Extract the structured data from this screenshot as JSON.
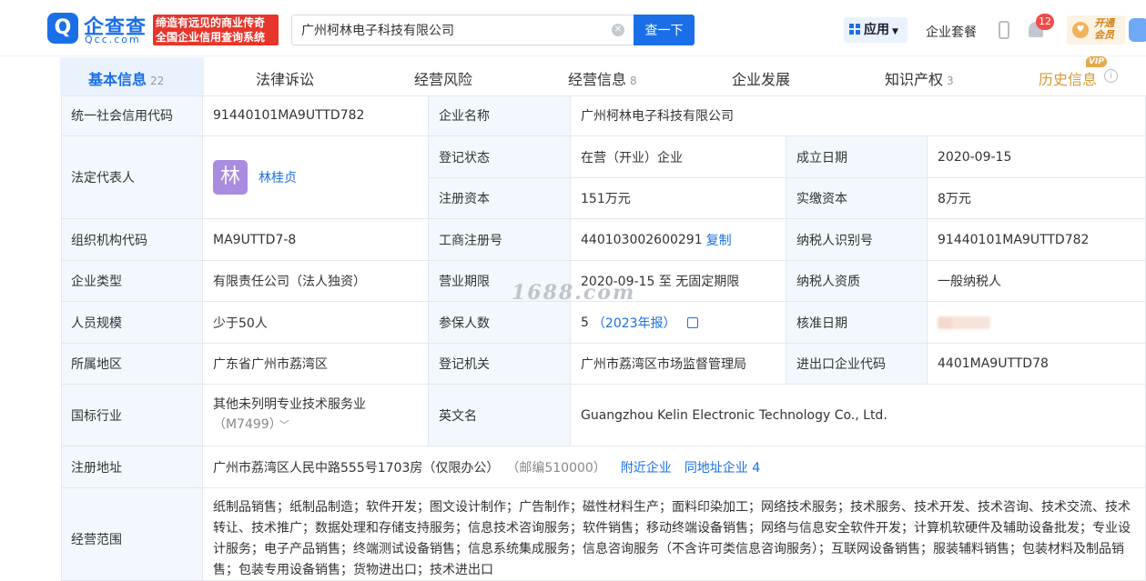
{
  "header": {
    "logo_mark": "Q",
    "logo_cn": "企查查",
    "logo_en": "Qcc.com",
    "slogan_line1": "缔造有远见的商业传奇",
    "slogan_line2": "全国企业信用查询系统",
    "search_value": "广州柯林电子科技有限公司",
    "search_button": "查一下",
    "app_label": "应用",
    "package_label": "企业套餐",
    "notification_count": "12",
    "vip_label": "开通\n会员"
  },
  "tabs": [
    {
      "label": "基本信息",
      "count": "22"
    },
    {
      "label": "法律诉讼",
      "count": ""
    },
    {
      "label": "经营风险",
      "count": ""
    },
    {
      "label": "经营信息",
      "count": "8"
    },
    {
      "label": "企业发展",
      "count": ""
    },
    {
      "label": "知识产权",
      "count": "3"
    },
    {
      "label": "历史信息",
      "count": "",
      "tag": "VIP"
    }
  ],
  "info": {
    "credit_code_label": "统一社会信用代码",
    "credit_code": "91440101MA9UTTD782",
    "company_name_label": "企业名称",
    "company_name": "广州柯林电子科技有限公司",
    "legal_rep_label": "法定代表人",
    "legal_rep_avatar": "林",
    "legal_rep": "林桂贞",
    "reg_status_label": "登记状态",
    "reg_status": "在营（开业）企业",
    "found_date_label": "成立日期",
    "found_date": "2020-09-15",
    "reg_capital_label": "注册资本",
    "reg_capital": "151万元",
    "paid_capital_label": "实缴资本",
    "paid_capital": "8万元",
    "org_code_label": "组织机构代码",
    "org_code": "MA9UTTD7-8",
    "biz_reg_no_label": "工商注册号",
    "biz_reg_no": "440103002600291",
    "copy_label": "复制",
    "taxpayer_id_label": "纳税人识别号",
    "taxpayer_id": "91440101MA9UTTD782",
    "company_type_label": "企业类型",
    "company_type": "有限责任公司（法人独资）",
    "biz_term_label": "营业期限",
    "biz_term": "2020-09-15 至 无固定期限",
    "taxpayer_qual_label": "纳税人资质",
    "taxpayer_qual": "一般纳税人",
    "staff_size_label": "人员规模",
    "staff_size": "少于50人",
    "insured_label": "参保人数",
    "insured_count": "5",
    "insured_report": "（2023年报）",
    "approve_date_label": "核准日期",
    "region_label": "所属地区",
    "region": "广东省广州市荔湾区",
    "reg_authority_label": "登记机关",
    "reg_authority": "广州市荔湾区市场监督管理局",
    "ie_code_label": "进出口企业代码",
    "ie_code": "4401MA9UTTD78",
    "industry_label": "国标行业",
    "industry": "其他未列明专业技术服务业",
    "industry_code": "（M7499）",
    "english_name_label": "英文名",
    "english_name": "Guangzhou Kelin Electronic Technology Co., Ltd.",
    "address_label": "注册地址",
    "address": "广州市荔湾区人民中路555号1703房（仅限办公）",
    "postcode": "（邮编510000）",
    "nearby_label": "附近企业",
    "same_address_label": "同地址企业 4",
    "scope_label": "经营范围",
    "scope": "纸制品销售；纸制品制造；软件开发；图文设计制作；广告制作；磁性材料生产；面料印染加工；网络技术服务；技术服务、技术开发、技术咨询、技术交流、技术转让、技术推广；数据处理和存储支持服务；信息技术咨询服务；软件销售；移动终端设备销售；网络与信息安全软件开发；计算机软硬件及辅助设备批发；专业设计服务；电子产品销售；终端测试设备销售；信息系统集成服务；信息咨询服务（不含许可类信息咨询服务）；互联网设备销售；服装辅料销售；包装材料及制品销售；包装专用设备销售；货物进出口；技术进出口"
  },
  "watermark": "1688.com",
  "colors": {
    "brand": "#1a6fe8",
    "label_bg": "#f2f8fe",
    "slogan_bg": "#e8352b",
    "badge": "#f04b4b",
    "vip": "#d69a3a"
  }
}
